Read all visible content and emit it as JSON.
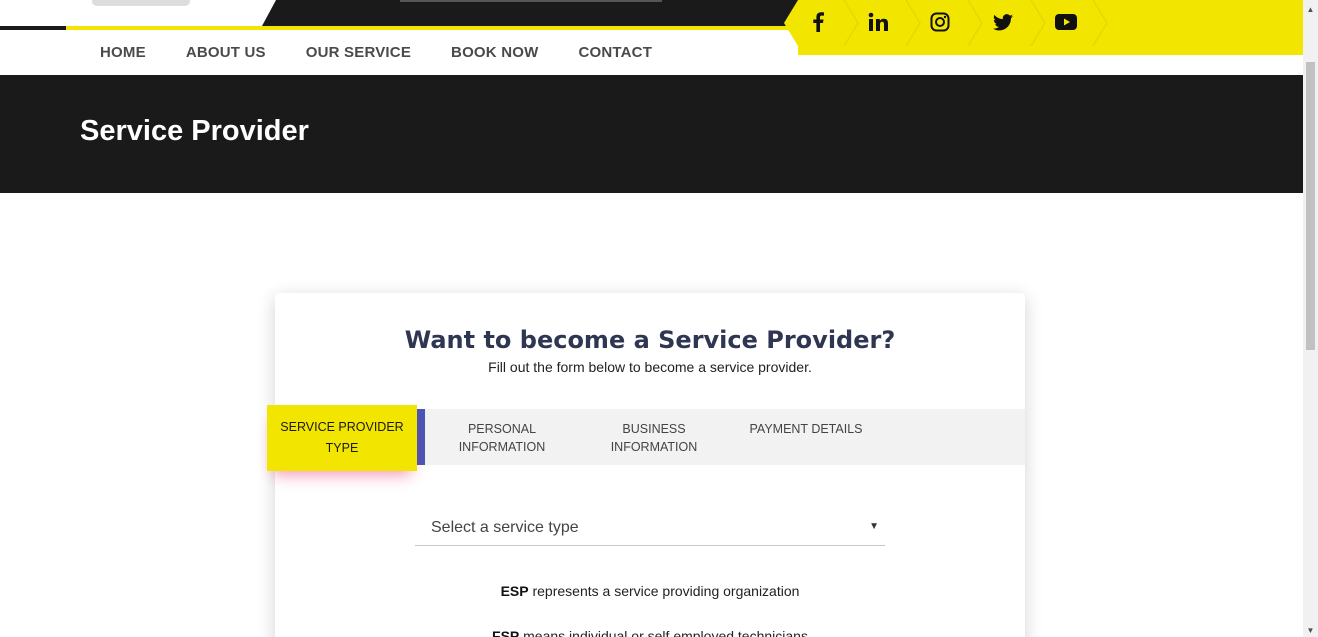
{
  "nav": {
    "items": [
      "HOME",
      "ABOUT US",
      "OUR SERVICE",
      "BOOK NOW",
      "CONTACT"
    ]
  },
  "social": {
    "icons": [
      "facebook-icon",
      "linkedin-icon",
      "instagram-icon",
      "twitter-icon",
      "youtube-icon"
    ]
  },
  "hero": {
    "title": "Service Provider"
  },
  "card": {
    "title": "Want to become a Service Provider?",
    "subtitle": "Fill out the form below to become a service provider."
  },
  "steps": {
    "active_line1": "SERVICE PROVIDER",
    "active_line2": "TYPE",
    "personal_line1": "PERSONAL",
    "personal_line2": "INFORMATION",
    "business_line1": "BUSINESS",
    "business_line2": "INFORMATION",
    "payment": "PAYMENT DETAILS"
  },
  "select": {
    "placeholder": "Select a service type"
  },
  "notes": {
    "esp_label": "ESP",
    "esp_text": " represents a service providing organization",
    "fsp_label": "FSP",
    "fsp_text": " means individual or self employed technicians"
  },
  "colors": {
    "accent_yellow": "#f2e600",
    "dark": "#1a1a1a",
    "step_accent": "#4b56b8",
    "title": "#2e3652"
  }
}
